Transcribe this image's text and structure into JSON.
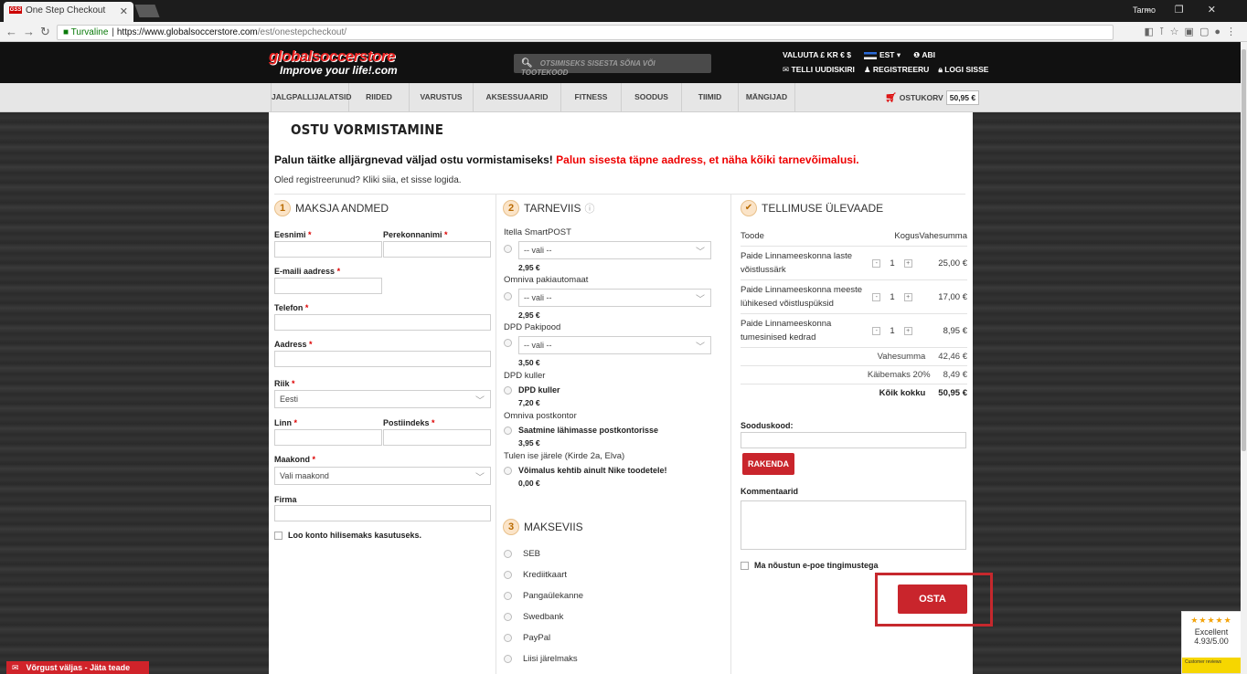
{
  "browser": {
    "tab_title": "One Step Checkout",
    "favicon_text": "GSS",
    "user": "Tarmo",
    "secure_label": "Turvaline",
    "url_host": "https://www.globalsoccerstore.com",
    "url_path": "/est/onestepcheckout/"
  },
  "header": {
    "logo_line1": "globalsoccerstore",
    "logo_line2": "Improve your life!.com",
    "search_placeholder": "OTSIMISEKS SISESTA SÕNA VÕI TOOTEKOOD",
    "currency": "VALUUTA £ KR € $",
    "language": "EST",
    "help": "ABI",
    "newsletter": "TELLI UUDISKIRI",
    "register": "REGISTREERU",
    "login": "LOGI SISSE"
  },
  "menu": {
    "items": [
      "JALGPALLIJALATSID",
      "RIIDED",
      "VARUSTUS",
      "AKSESSUAARID",
      "FITNESS",
      "SOODUS",
      "TIIMID",
      "MÄNGIJAD"
    ],
    "cart_label": "OSTUKORV",
    "cart_amount": "50,95 €"
  },
  "page": {
    "title": "OSTU VORMISTAMINE",
    "instruction": "Palun täitke alljärgnevad väljad ostu vormistamiseks!",
    "instruction_red": "Palun sisesta täpne aadress, et näha kõiki tarnevõimalusi.",
    "registered": "Oled registreerunud? Kliki siia, et sisse logida."
  },
  "billing": {
    "heading_num": "1",
    "heading": "MAKSJA ANDMED",
    "first_name": "Eesnimi",
    "last_name": "Perekonnanimi",
    "email": "E-maili aadress",
    "phone": "Telefon",
    "address": "Aadress",
    "country": "Riik",
    "country_value": "Eesti",
    "city": "Linn",
    "postcode": "Postiindeks",
    "county": "Maakond",
    "county_value": "Vali maakond",
    "company": "Firma",
    "create_account": "Loo konto hilisemaks kasutuseks.",
    "req": "*"
  },
  "shipping": {
    "heading_num": "2",
    "heading": "TARNEVIIS",
    "methods": [
      {
        "name": "Itella SmartPOST",
        "select": "-- vali --",
        "price": "2,95 €"
      },
      {
        "name": "Omniva pakiautomaat",
        "select": "-- vali --",
        "price": "2,95 €"
      },
      {
        "name": "DPD Pakipood",
        "select": "-- vali --",
        "price": "3,50 €"
      }
    ],
    "options": [
      {
        "group": "DPD kuller",
        "label": "DPD kuller",
        "price": "7,20 €"
      },
      {
        "group": "Omniva postkontor",
        "label": "Saatmine lähimasse postkontorisse",
        "price": "3,95 €"
      },
      {
        "group": "Tulen ise järele (Kirde 2a, Elva)",
        "label": "Võimalus kehtib ainult Nike toodetele!",
        "price": "0,00 €"
      }
    ]
  },
  "payment": {
    "heading_num": "3",
    "heading": "MAKSEVIIS",
    "methods": [
      "SEB",
      "Krediitkaart",
      "Pangaülekanne",
      "Swedbank",
      "PayPal",
      "Liisi järelmaks"
    ]
  },
  "summary": {
    "heading": "TELLIMUSE ÜLEVAADE",
    "col_product": "Toode",
    "col_qty": "Kogus",
    "col_subtotal": "Vahesumma",
    "items": [
      {
        "name": "Paide Linnameeskonna laste võistlussärk",
        "qty": "1",
        "price": "25,00 €"
      },
      {
        "name": "Paide Linnameeskonna meeste lühikesed võistluspüksid",
        "qty": "1",
        "price": "17,00 €"
      },
      {
        "name": "Paide Linnameeskonna tumesinised kedrad",
        "qty": "1",
        "price": "8,95 €"
      }
    ],
    "subtotal_label": "Vahesumma",
    "subtotal": "42,46 €",
    "tax_label": "Käibemaks 20%",
    "tax": "8,49 €",
    "total_label": "Kõik kokku",
    "total": "50,95 €",
    "coupon_label": "Sooduskood:",
    "apply": "RAKENDA",
    "comments_label": "Kommentaarid",
    "terms": "Ma nõustun e-poe tingimustega",
    "submit": "OSTA",
    "minus": "-",
    "plus": "+"
  },
  "widgets": {
    "chat": "Võrgust väljas - Jäta teade",
    "rating_label": "Excellent",
    "rating_value": "4.93/5.00",
    "rating_strip": "Customer reviews"
  },
  "colors": {
    "accent_red": "#c9252c",
    "header_bg": "#111111"
  }
}
